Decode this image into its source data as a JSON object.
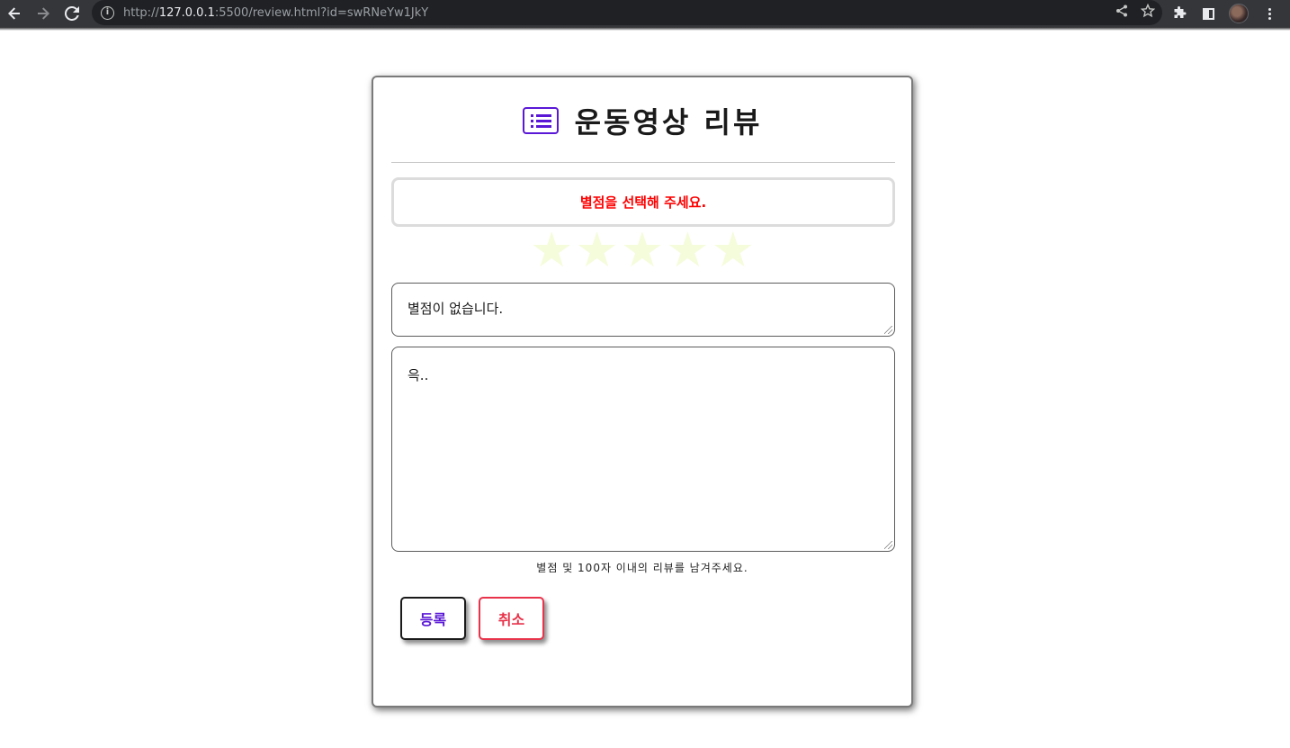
{
  "browser": {
    "url_prefix": "http://",
    "url_host": "127.0.0.1",
    "url_rest": ":5500/review.html?id=swRNeYw1JkY"
  },
  "review": {
    "title": "운동영상 리뷰",
    "rating_message": "별점을 선택해 주세요.",
    "rating_value": 0,
    "rating_max": 5,
    "star_glyph": "★",
    "star_color": "#f5fcdc",
    "rating_summary_value": "별점이 없습니다.",
    "content_value": "윽..",
    "hint": "별점 및 100자 이내의 리뷰를 남겨주세요.",
    "submit_label": "등록",
    "cancel_label": "취소"
  },
  "colors": {
    "accent": "#5a18d6",
    "warning": "#ff0000",
    "cancel": "#e8334a"
  }
}
